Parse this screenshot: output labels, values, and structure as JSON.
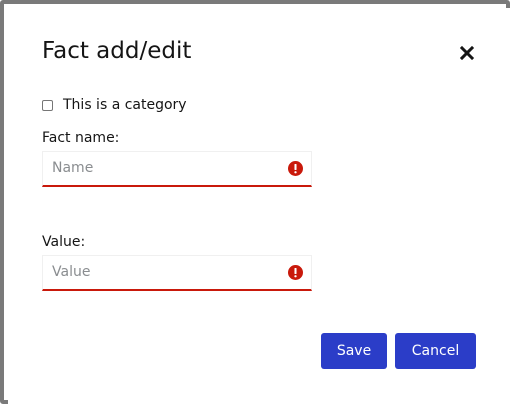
{
  "dialog": {
    "title": "Fact add/edit",
    "close_icon": "close-icon"
  },
  "category_checkbox": {
    "label": "This is a category",
    "checked": false
  },
  "fact_name": {
    "label": "Fact name:",
    "placeholder": "Name",
    "value": "",
    "error_icon": "exclamation-circle-icon"
  },
  "fact_value": {
    "label": "Value:",
    "placeholder": "Value",
    "value": "",
    "error_icon": "exclamation-circle-icon"
  },
  "actions": {
    "save_label": "Save",
    "cancel_label": "Cancel"
  },
  "colors": {
    "primary": "#2b3dc8",
    "error": "#c9190b",
    "text": "#151515",
    "placeholder": "#8a8d90"
  }
}
